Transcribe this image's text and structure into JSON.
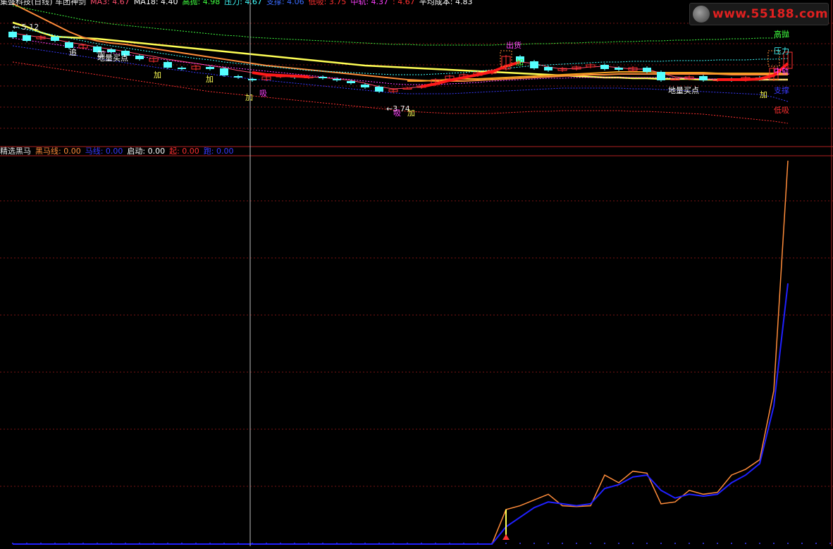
{
  "top_header": [
    {
      "text": "集盛科技(日线) 车团神剑",
      "color": "#e8e8e8"
    },
    {
      "text": "MA3: 4.67",
      "color": "#ff4d6d"
    },
    {
      "text": "MA18: 4.40",
      "color": "#ffffff"
    },
    {
      "text": "高抛: 4.98",
      "color": "#40ff40"
    },
    {
      "text": "压力: 4.67",
      "color": "#40ffff"
    },
    {
      "text": "支撑: 4.06",
      "color": "#3a6bff"
    },
    {
      "text": "低吸: 3.75",
      "color": "#ff3030"
    },
    {
      "text": "中轨: 4.37",
      "color": "#ff40ff"
    },
    {
      "text": ": 4.67",
      "color": "#ff3030"
    },
    {
      "text": "平均成本: 4.83",
      "color": "#ffffff"
    }
  ],
  "bottom_header": [
    {
      "text": "精选黑马",
      "color": "#e8e8e8"
    },
    {
      "text": "黑马线: 0.00",
      "color": "#ff8c3a"
    },
    {
      "text": "马线: 0.00",
      "color": "#3a3aff"
    },
    {
      "text": "启动: 0.00",
      "color": "#ffffff"
    },
    {
      "text": "起: 0.00",
      "color": "#ff3030"
    },
    {
      "text": "跑: 0.00",
      "color": "#3a3aff"
    }
  ],
  "watermark": {
    "text": "www.55188.com",
    "color": "#e02020"
  },
  "chart_data": [
    {
      "type": "candlestick",
      "panel": "main",
      "ylim": [
        3.5,
        5.4
      ],
      "grid": "dashed-horizontal",
      "candles": [
        {
          "o": 5.05,
          "c": 4.97
        },
        {
          "o": 5.0,
          "c": 4.92
        },
        {
          "o": 4.95,
          "c": 4.98
        },
        {
          "o": 4.98,
          "c": 4.92
        },
        {
          "o": 4.9,
          "c": 4.82
        },
        {
          "o": 4.82,
          "c": 4.86
        },
        {
          "o": 4.84,
          "c": 4.76
        },
        {
          "o": 4.8,
          "c": 4.76
        },
        {
          "o": 4.78,
          "c": 4.71
        },
        {
          "o": 4.71,
          "c": 4.66
        },
        {
          "o": 4.63,
          "c": 4.67
        },
        {
          "o": 4.62,
          "c": 4.54
        },
        {
          "o": 4.54,
          "c": 4.52
        },
        {
          "o": 4.52,
          "c": 4.56
        },
        {
          "o": 4.55,
          "c": 4.52
        },
        {
          "o": 4.53,
          "c": 4.43
        },
        {
          "o": 4.42,
          "c": 4.4
        },
        {
          "o": 4.38,
          "c": 4.36
        },
        {
          "o": 4.37,
          "c": 4.41
        },
        {
          "o": 4.41,
          "c": 4.43
        },
        {
          "o": 4.42,
          "c": 4.4
        },
        {
          "o": 4.4,
          "c": 4.41
        },
        {
          "o": 4.41,
          "c": 4.39
        },
        {
          "o": 4.38,
          "c": 4.36
        },
        {
          "o": 4.35,
          "c": 4.32
        },
        {
          "o": 4.3,
          "c": 4.26
        },
        {
          "o": 4.27,
          "c": 4.2
        },
        {
          "o": 4.2,
          "c": 4.23
        },
        {
          "o": 4.25,
          "c": 4.25
        },
        {
          "o": 4.26,
          "c": 4.28
        },
        {
          "o": 4.3,
          "c": 4.37
        },
        {
          "o": 4.38,
          "c": 4.42
        },
        {
          "o": 4.4,
          "c": 4.44
        },
        {
          "o": 4.43,
          "c": 4.47
        },
        {
          "o": 4.46,
          "c": 4.5
        },
        {
          "o": 4.52,
          "c": 4.7
        },
        {
          "o": 4.7,
          "c": 4.62
        },
        {
          "o": 4.63,
          "c": 4.53
        },
        {
          "o": 4.55,
          "c": 4.5
        },
        {
          "o": 4.5,
          "c": 4.53
        },
        {
          "o": 4.52,
          "c": 4.55
        },
        {
          "o": 4.55,
          "c": 4.58
        },
        {
          "o": 4.58,
          "c": 4.52
        },
        {
          "o": 4.54,
          "c": 4.51
        },
        {
          "o": 4.5,
          "c": 4.54
        },
        {
          "o": 4.54,
          "c": 4.48
        },
        {
          "o": 4.48,
          "c": 4.36
        },
        {
          "o": 4.38,
          "c": 4.38
        },
        {
          "o": 4.38,
          "c": 4.41
        },
        {
          "o": 4.42,
          "c": 4.36
        },
        {
          "o": 4.36,
          "c": 4.37
        },
        {
          "o": 4.38,
          "c": 4.36
        },
        {
          "o": 4.36,
          "c": 4.4
        },
        {
          "o": 4.4,
          "c": 4.37
        },
        {
          "o": 4.37,
          "c": 4.53
        },
        {
          "o": 4.53,
          "c": 4.76
        }
      ],
      "series": [
        {
          "color": "#ffff55",
          "width": 2.5,
          "values": [
            5.18,
            5.12,
            5.04,
            4.98,
            4.97,
            4.96,
            4.95,
            4.93,
            4.91,
            4.89,
            4.87,
            4.85,
            4.83,
            4.81,
            4.79,
            4.77,
            4.75,
            4.73,
            4.71,
            4.69,
            4.67,
            4.65,
            4.63,
            4.61,
            4.59,
            4.57,
            4.56,
            4.55,
            4.54,
            4.53,
            4.52,
            4.51,
            4.5,
            4.49,
            4.48,
            4.47,
            4.46,
            4.45,
            4.44,
            4.43,
            4.42,
            4.41,
            4.4,
            4.4,
            4.39,
            4.39,
            4.38,
            4.38,
            4.38,
            4.37,
            4.37,
            4.37,
            4.37,
            4.37,
            4.37,
            4.37
          ]
        },
        {
          "color": "#ff8c3a",
          "width": 2,
          "values": [
            5.45,
            5.35,
            5.25,
            5.15,
            5.05,
            4.97,
            4.92,
            4.89,
            4.87,
            4.84,
            4.81,
            4.78,
            4.75,
            4.72,
            4.69,
            4.66,
            4.63,
            4.6,
            4.57,
            4.55,
            4.53,
            4.51,
            4.49,
            4.47,
            4.45,
            4.43,
            4.41,
            4.39,
            4.37,
            4.36,
            4.35,
            4.35,
            4.35,
            4.36,
            4.37,
            4.38,
            4.39,
            4.4,
            4.41,
            4.42,
            4.43,
            4.44,
            4.44,
            4.45,
            4.45,
            4.45,
            4.45,
            4.45,
            4.45,
            4.45,
            4.45,
            4.44,
            4.44,
            4.44,
            4.44,
            4.44
          ]
        },
        {
          "color": "#f2a020",
          "width": 2,
          "values": [
            null,
            null,
            null,
            null,
            null,
            null,
            null,
            null,
            null,
            null,
            null,
            null,
            null,
            null,
            null,
            null,
            null,
            null,
            null,
            null,
            null,
            null,
            null,
            null,
            null,
            null,
            null,
            null,
            4.35,
            4.35,
            4.36,
            4.37,
            4.38,
            4.38,
            4.39,
            4.4,
            4.41,
            4.42,
            4.43,
            4.44,
            4.45,
            4.46,
            4.47,
            4.48,
            4.48,
            4.48,
            4.47,
            4.47,
            4.47,
            4.47,
            4.46,
            4.46,
            4.46,
            4.46,
            4.46,
            4.46
          ]
        },
        {
          "color": "#ff4d6d",
          "width": 1,
          "values": [
            5.03,
            5.0,
            4.97,
            4.94,
            4.9,
            4.87,
            4.83,
            4.8,
            4.77,
            4.73,
            4.7,
            4.66,
            4.63,
            4.6,
            4.57,
            4.54,
            4.5,
            4.47,
            4.44,
            4.43,
            4.42,
            4.41,
            4.4,
            4.38,
            4.36,
            4.32,
            4.27,
            4.24,
            4.25,
            4.27,
            4.31,
            4.36,
            4.4,
            4.44,
            4.48,
            4.56,
            4.62,
            4.6,
            4.55,
            4.52,
            4.53,
            4.55,
            4.56,
            4.54,
            4.52,
            4.52,
            4.46,
            4.41,
            4.39,
            4.38,
            4.37,
            4.37,
            4.37,
            4.38,
            4.43,
            4.6
          ]
        },
        {
          "color": "#40ff40",
          "width": 1,
          "dash": "2,2",
          "values": [
            5.42,
            5.38,
            5.34,
            5.3,
            5.26,
            5.22,
            5.19,
            5.16,
            5.14,
            5.12,
            5.1,
            5.08,
            5.06,
            5.04,
            5.02,
            5.0,
            4.99,
            4.97,
            4.96,
            4.95,
            4.94,
            4.93,
            4.92,
            4.91,
            4.9,
            4.89,
            4.88,
            4.87,
            4.87,
            4.86,
            4.86,
            4.86,
            4.86,
            4.86,
            4.86,
            4.87,
            4.87,
            4.88,
            4.88,
            4.89,
            4.89,
            4.9,
            4.9,
            4.91,
            4.91,
            4.92,
            4.92,
            4.93,
            4.93,
            4.94,
            4.94,
            4.95,
            4.95,
            4.96,
            4.96,
            4.98
          ]
        },
        {
          "color": "#40ffff",
          "width": 1,
          "dash": "2,2",
          "values": [
            5.12,
            5.08,
            5.04,
            5.0,
            4.96,
            4.92,
            4.88,
            4.85,
            4.82,
            4.79,
            4.76,
            4.73,
            4.7,
            4.67,
            4.65,
            4.62,
            4.6,
            4.58,
            4.56,
            4.54,
            4.52,
            4.5,
            4.49,
            4.48,
            4.47,
            4.46,
            4.45,
            4.44,
            4.44,
            4.44,
            4.45,
            4.46,
            4.47,
            4.49,
            4.51,
            4.53,
            4.55,
            4.57,
            4.58,
            4.59,
            4.6,
            4.61,
            4.62,
            4.62,
            4.63,
            4.63,
            4.63,
            4.64,
            4.64,
            4.64,
            4.65,
            4.65,
            4.65,
            4.66,
            4.66,
            4.67
          ]
        },
        {
          "color": "#ff40ff",
          "width": 1,
          "dash": "2,2",
          "values": [
            4.96,
            4.93,
            4.9,
            4.87,
            4.84,
            4.81,
            4.78,
            4.75,
            4.73,
            4.7,
            4.67,
            4.65,
            4.62,
            4.6,
            4.57,
            4.55,
            4.53,
            4.51,
            4.49,
            4.47,
            4.45,
            4.43,
            4.41,
            4.39,
            4.37,
            4.35,
            4.33,
            4.31,
            4.3,
            4.3,
            4.3,
            4.31,
            4.32,
            4.33,
            4.35,
            4.36,
            4.37,
            4.38,
            4.39,
            4.39,
            4.4,
            4.4,
            4.4,
            4.4,
            4.4,
            4.4,
            4.4,
            4.39,
            4.39,
            4.38,
            4.38,
            4.38,
            4.37,
            4.37,
            4.37,
            4.37
          ]
        },
        {
          "color": "#3a3aff",
          "width": 1,
          "dash": "2,2",
          "values": [
            4.85,
            4.82,
            4.79,
            4.76,
            4.73,
            4.7,
            4.67,
            4.64,
            4.61,
            4.58,
            4.55,
            4.52,
            4.5,
            4.47,
            4.45,
            4.42,
            4.4,
            4.38,
            4.36,
            4.34,
            4.32,
            4.3,
            4.28,
            4.26,
            4.24,
            4.22,
            4.2,
            4.18,
            4.17,
            4.17,
            4.17,
            4.17,
            4.18,
            4.19,
            4.2,
            4.21,
            4.22,
            4.23,
            4.24,
            4.25,
            4.25,
            4.25,
            4.25,
            4.25,
            4.24,
            4.24,
            4.23,
            4.22,
            4.21,
            4.2,
            4.19,
            4.18,
            4.17,
            4.16,
            4.12,
            4.06
          ]
        },
        {
          "color": "#ff3030",
          "width": 1,
          "dash": "2,2",
          "values": [
            4.62,
            4.59,
            4.56,
            4.53,
            4.5,
            4.47,
            4.44,
            4.41,
            4.38,
            4.35,
            4.32,
            4.29,
            4.26,
            4.23,
            4.2,
            4.18,
            4.16,
            4.14,
            4.12,
            4.1,
            4.08,
            4.06,
            4.04,
            4.02,
            4.0,
            3.98,
            3.96,
            3.94,
            3.92,
            3.91,
            3.9,
            3.89,
            3.89,
            3.89,
            3.89,
            3.9,
            3.91,
            3.92,
            3.92,
            3.93,
            3.93,
            3.93,
            3.93,
            3.93,
            3.92,
            3.92,
            3.91,
            3.9,
            3.89,
            3.88,
            3.86,
            3.84,
            3.82,
            3.8,
            3.78,
            3.75
          ]
        }
      ],
      "thick_red_segments": [
        {
          "from": 17,
          "to": 21,
          "color": "#ff1a1a"
        },
        {
          "from": 29,
          "to": 36,
          "color": "#ff1a1a"
        },
        {
          "from": 50,
          "to": 55,
          "color": "#ff1a1a"
        }
      ],
      "annotations": [
        {
          "text": "← 5.12",
          "i": 0.0,
          "y": 5.08,
          "color": "#e8e8e8"
        },
        {
          "text": "←3.74",
          "i": 26.5,
          "y": 3.92,
          "color": "#e8e8e8"
        },
        {
          "text": "追",
          "i": 4.0,
          "y": 4.72,
          "color": "#ffffff"
        },
        {
          "text": "加",
          "i": 6.0,
          "y": 4.7,
          "color": "#ffffff"
        },
        {
          "text": "地量买点",
          "i": 6.0,
          "y": 4.64,
          "color": "#ffffff"
        },
        {
          "text": "加",
          "i": 10.0,
          "y": 4.4,
          "color": "#ffff55"
        },
        {
          "text": "加",
          "i": 13.7,
          "y": 4.34,
          "color": "#ffff55"
        },
        {
          "text": "加",
          "i": 16.5,
          "y": 4.08,
          "color": "#ffff55"
        },
        {
          "text": "吸",
          "i": 17.5,
          "y": 4.14,
          "color": "#ff40ff"
        },
        {
          "text": "吸",
          "i": 27.0,
          "y": 3.86,
          "color": "#ff40ff"
        },
        {
          "text": "加",
          "i": 28.0,
          "y": 3.86,
          "color": "#ffff55"
        },
        {
          "text": "出货",
          "i": 35.0,
          "y": 4.82,
          "color": "#ff40ff"
        },
        {
          "text": "加",
          "i": 35.7,
          "y": 4.58,
          "color": "#40ff40"
        },
        {
          "text": "地量买点",
          "i": 46.5,
          "y": 4.18,
          "color": "#ffffff"
        },
        {
          "text": "加",
          "i": 53.0,
          "y": 4.12,
          "color": "#ffff55"
        },
        {
          "text": "高抛",
          "i": 54.0,
          "y": 4.98,
          "color": "#40ff40"
        },
        {
          "text": "压力",
          "i": 54.0,
          "y": 4.74,
          "color": "#40ffff"
        },
        {
          "text": "中轨",
          "i": 54.0,
          "y": 4.45,
          "color": "#ff40ff"
        },
        {
          "text": "支撑",
          "i": 54.0,
          "y": 4.18,
          "color": "#3a3aff"
        },
        {
          "text": "低吸",
          "i": 54.0,
          "y": 3.9,
          "color": "#ff3030"
        }
      ]
    },
    {
      "type": "line",
      "panel": "indicator",
      "ylim": [
        0,
        100
      ],
      "grid": "dashed-horizontal",
      "series": [
        {
          "color": "#ff8c3a",
          "width": 1.5,
          "values": [
            0,
            0,
            0,
            0,
            0,
            0,
            0,
            0,
            0,
            0,
            0,
            0,
            0,
            0,
            0,
            0,
            0,
            0,
            0,
            0,
            0,
            0,
            0,
            0,
            0,
            0,
            0,
            0,
            0,
            0,
            0,
            0,
            0,
            0,
            0,
            9,
            10,
            11.5,
            13,
            10,
            9.8,
            10,
            18,
            16,
            19,
            18.5,
            10.5,
            11,
            14,
            13,
            13.5,
            18,
            19.5,
            22,
            40,
            100
          ]
        },
        {
          "color": "#2020ff",
          "width": 2,
          "values": [
            0,
            0,
            0,
            0,
            0,
            0,
            0,
            0,
            0,
            0,
            0,
            0,
            0,
            0,
            0,
            0,
            0,
            0,
            0,
            0,
            0,
            0,
            0,
            0,
            0,
            0,
            0,
            0,
            0,
            0,
            0,
            0,
            0,
            0,
            0,
            4.5,
            7,
            9.5,
            11,
            10.5,
            10,
            10.5,
            14.5,
            15.5,
            17.5,
            18,
            14,
            12,
            13,
            12.5,
            13,
            16,
            18,
            21,
            36,
            68
          ]
        }
      ],
      "start_marker": {
        "i": 35,
        "color": "#ff3030"
      }
    }
  ]
}
